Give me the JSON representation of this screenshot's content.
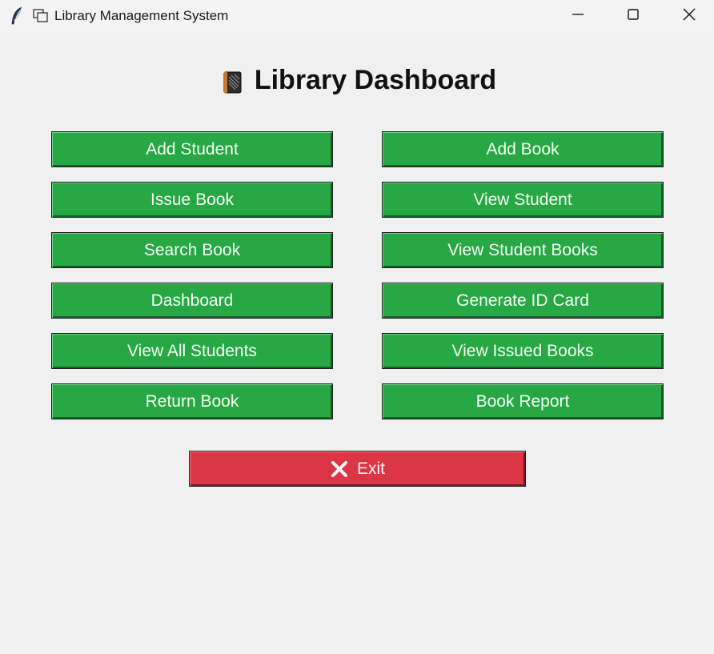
{
  "window": {
    "title": "Library Management System",
    "icons": [
      "feather-icon",
      "window-copy-icon"
    ],
    "controls": [
      "minimize-icon",
      "maximize-icon",
      "close-icon"
    ]
  },
  "dashboard": {
    "heading_icon": "book-icon",
    "title": "Library Dashboard"
  },
  "buttons": {
    "left": [
      "Add Student",
      "Issue Book",
      "Search Book",
      "Dashboard",
      "View All Students",
      "Return Book"
    ],
    "right": [
      "Add Book",
      "View Student",
      "View Student Books",
      "Generate ID Card",
      "View Issued Books",
      "Book Report"
    ]
  },
  "exit": {
    "icon": "x-icon",
    "label": "Exit"
  },
  "colors": {
    "primary_button": "#28a745",
    "exit_button": "#dc3545",
    "background": "#f0f0f0"
  }
}
